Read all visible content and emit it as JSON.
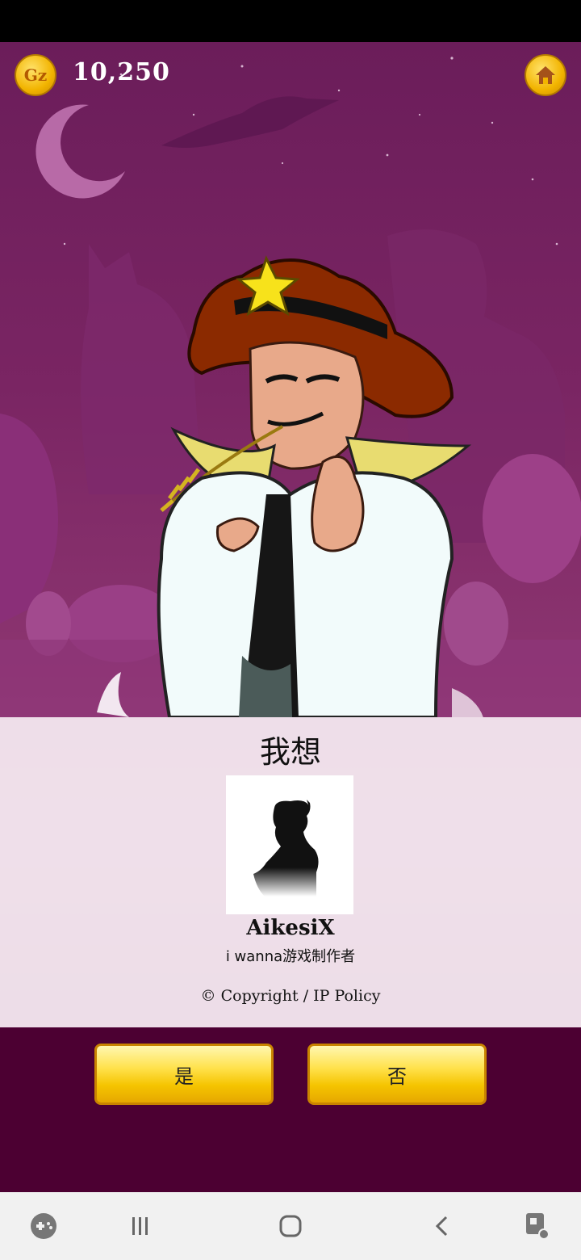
{
  "header": {
    "coin_icon_text": "Gz",
    "coins": "10,250",
    "home_icon": "home-icon"
  },
  "dialog": {
    "question": "我想",
    "character_name": "AikesiX",
    "character_desc": "i wanna游戏制作者",
    "copyright": "© Copyright / IP Policy"
  },
  "answers": {
    "yes": "是",
    "no": "否"
  },
  "navbar": {
    "items": [
      "game-launcher-icon",
      "recents-icon",
      "home-icon",
      "back-icon",
      "screen-assist-icon"
    ]
  },
  "colors": {
    "background": "#6b1d5a",
    "bottom": "#4c0032",
    "gold": "#f5c400"
  }
}
